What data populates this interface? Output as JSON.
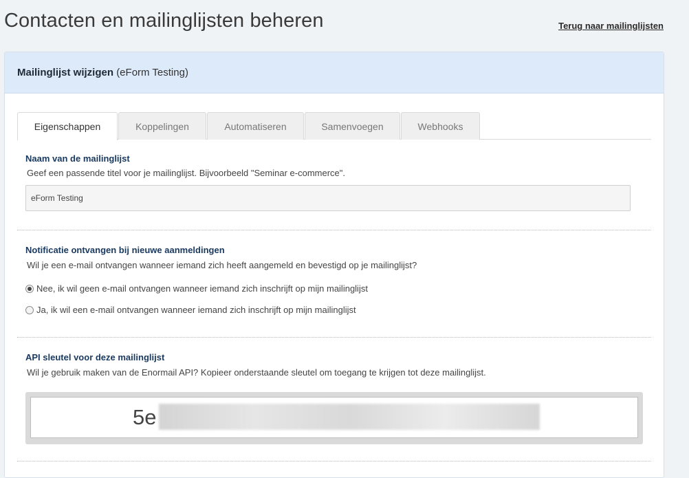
{
  "page": {
    "title": "Contacten en mailinglijsten beheren",
    "back_link": "Terug naar mailinglijsten"
  },
  "panel": {
    "header_strong": "Mailinglijst wijzigen",
    "header_sub": "(eForm Testing)"
  },
  "tabs": [
    {
      "label": "Eigenschappen",
      "active": true
    },
    {
      "label": "Koppelingen",
      "active": false
    },
    {
      "label": "Automatiseren",
      "active": false
    },
    {
      "label": "Samenvoegen",
      "active": false
    },
    {
      "label": "Webhooks",
      "active": false
    }
  ],
  "name_section": {
    "title": "Naam van de mailinglijst",
    "description": "Geef een passende titel voor je mailinglijst. Bijvoorbeeld \"Seminar e-commerce\".",
    "value": "eForm Testing"
  },
  "notification_section": {
    "title": "Notificatie ontvangen bij nieuwe aanmeldingen",
    "description": "Wil je een e-mail ontvangen wanneer iemand zich heeft aangemeld en bevestigd op je mailinglijst?",
    "options": [
      {
        "label": "Nee, ik wil geen e-mail ontvangen wanneer iemand zich inschrijft op mijn mailinglijst",
        "checked": true
      },
      {
        "label": "Ja, ik wil een e-mail ontvangen wanneer iemand zich inschrijft op mijn mailinglijst",
        "checked": false
      }
    ]
  },
  "api_section": {
    "title": "API sleutel voor deze mailinglijst",
    "description": "Wil je gebruik maken van de Enormail API? Kopieer onderstaande sleutel om toegang te krijgen tot deze mailinglijst.",
    "key_visible": "5e"
  }
}
